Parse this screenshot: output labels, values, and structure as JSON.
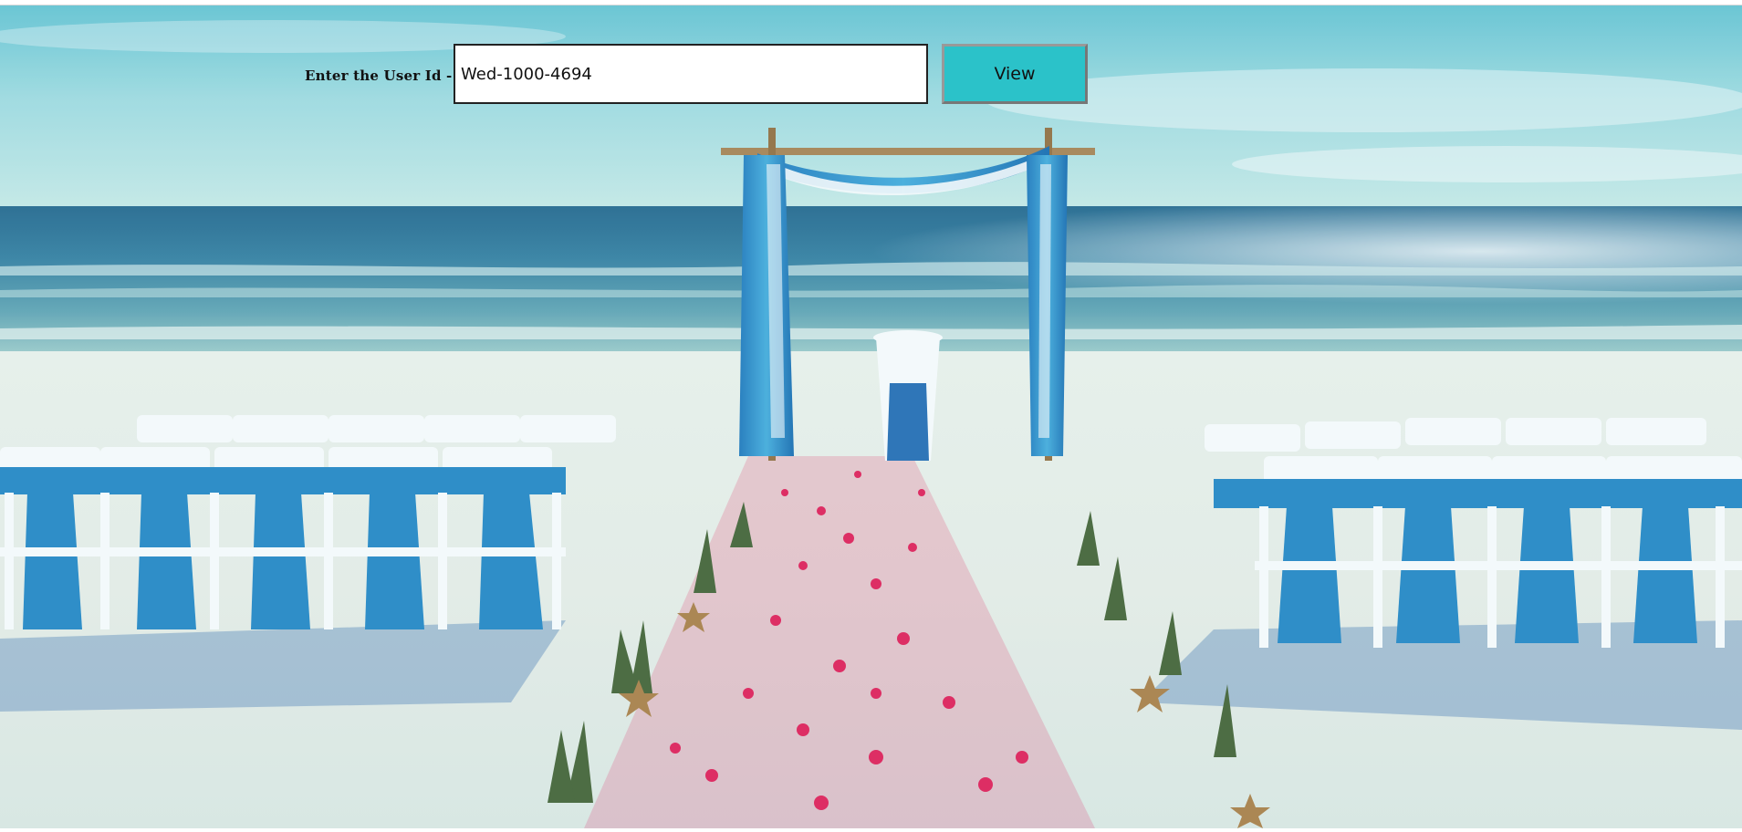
{
  "form": {
    "label": "Enter the User Id -",
    "user_id_value": "Wed-1000-4694",
    "view_label": "View"
  },
  "background": {
    "subject": "beach-wedding-ceremony-image"
  }
}
